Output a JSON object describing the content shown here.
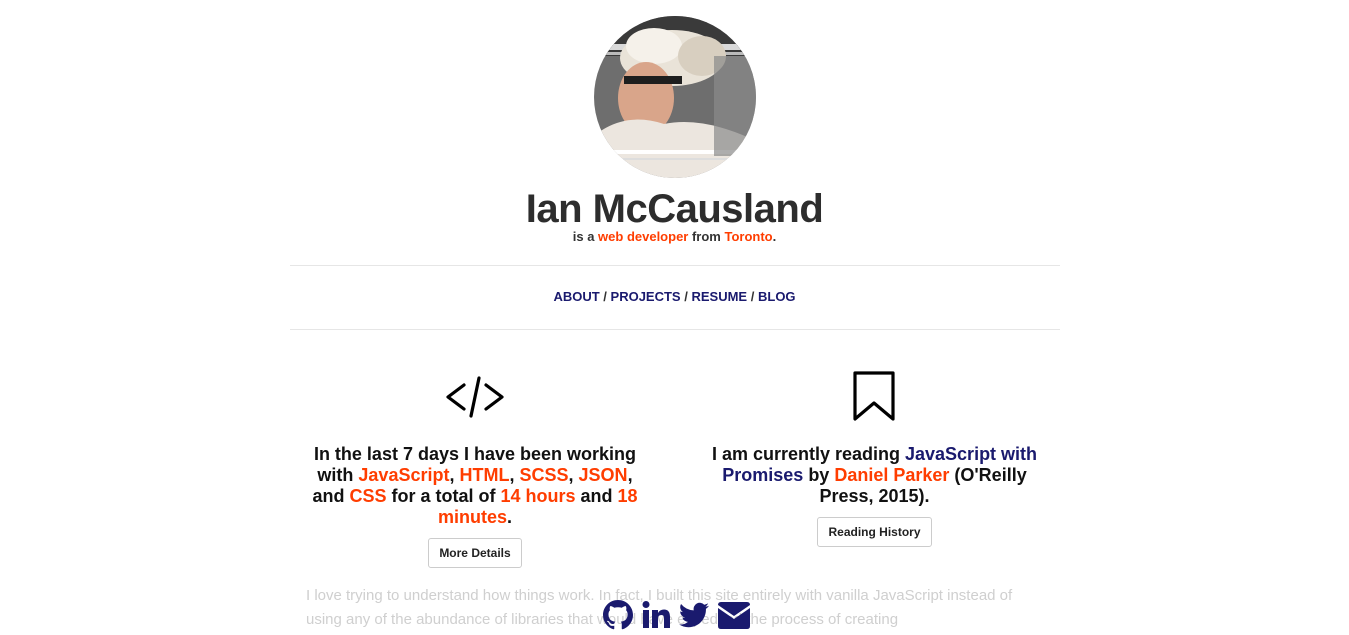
{
  "header": {
    "name": "Ian McCausland",
    "tagline_prefix": "is a ",
    "tagline_role": "web developer",
    "tagline_mid": " from ",
    "tagline_city": "Toronto",
    "tagline_suffix": "."
  },
  "nav": {
    "items": [
      "ABOUT",
      "PROJECTS",
      "RESUME",
      "BLOG"
    ],
    "separator": "/"
  },
  "coding": {
    "icon": "code-icon",
    "intro": "In the last 7 days I have been working with ",
    "lang1": "JavaScript",
    "sep1": ", ",
    "lang2": "HTML",
    "sep2": ", ",
    "lang3": "SCSS",
    "sep3": ", ",
    "lang4": "JSON",
    "sep4": ", and ",
    "lang5": "CSS",
    "mid": " for a total of ",
    "hours": "14 hours",
    "and": " and ",
    "minutes": "18 minutes",
    "end": ".",
    "button_label": "More Details"
  },
  "reading": {
    "icon": "bookmark-icon",
    "intro": "I am currently reading ",
    "book_title": "JavaScript with Promises",
    "by": " by ",
    "author": "Daniel Parker",
    "publisher": " (O'Reilly Press, 2015).",
    "button_label": "Reading History"
  },
  "about": {
    "text": "I love trying to understand how things work. In fact, I built this site entirely with vanilla JavaScript instead of using any of the abundance of libraries that would have expedited the process of creating"
  },
  "social": {
    "icons": [
      "github-icon",
      "linkedin-icon",
      "twitter-icon",
      "email-icon"
    ]
  },
  "colors": {
    "accent": "#ff3d00",
    "link_navy": "#1a1a6e",
    "text": "#333333"
  }
}
